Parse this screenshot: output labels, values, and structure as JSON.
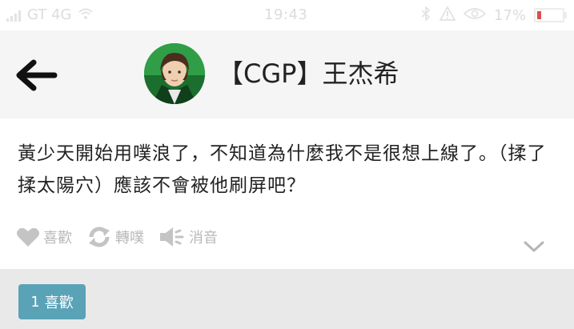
{
  "statusbar": {
    "carrier": "GT 4G",
    "time": "19:43",
    "battery": "17%",
    "battery_level": 0.17,
    "icons": [
      "signal-icon",
      "wifi-icon",
      "bluetooth-icon",
      "alert-icon",
      "eye-icon",
      "battery-icon"
    ]
  },
  "header": {
    "title": "【CGP】王杰希",
    "back_icon": "arrow-left-icon",
    "avatar_alt": "avatar"
  },
  "post": {
    "text": "黃少天開始用噗浪了，不知道為什麼我不是很想上線了。（揉了揉太陽穴）應該不會被他刷屏吧？"
  },
  "actions": {
    "like_label": "喜歡",
    "reblog_label": "轉噗",
    "mute_label": "消音"
  },
  "footer": {
    "likes_count": "1",
    "likes_label": "喜歡"
  },
  "colors": {
    "accent": "#5aa2b6",
    "header_bg": "#f5f5f5",
    "footer_bg": "#e9e9e9",
    "muted": "#b8b8b8"
  }
}
